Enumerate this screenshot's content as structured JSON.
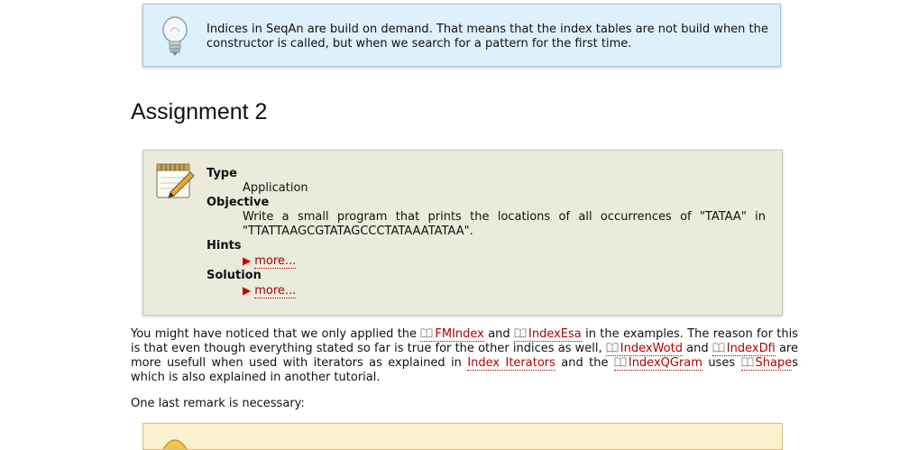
{
  "tip": {
    "text": "Indices in SeqAn are build on demand. That means that the index tables are not build when the constructor is called, but when we search for a pattern for the first time."
  },
  "assignment": {
    "title": "Assignment 2",
    "type_label": "Type",
    "type_value": "Application",
    "objective_label": "Objective",
    "objective_value": "Write a small program that prints the locations of all occurrences of \"TATAA\" in \"TTATTAAGCGTATAGCCCTATAAATATAA\".",
    "hints_label": "Hints",
    "hints_more": "more...",
    "solution_label": "Solution",
    "solution_more": "more..."
  },
  "paragraph": {
    "t1": "You might have noticed that we only applied the ",
    "link_fmindex": "FMIndex",
    "t2": " and ",
    "link_indexesa": "IndexEsa",
    "t3": " in the examples. The reason for this is that even though everything stated so far is true for the other indices as well, ",
    "link_indexwotd": "IndexWotd",
    "t4": " and ",
    "link_indexdfi": "IndexDfi",
    "t5": " are more usefull when used with iterators as explained in ",
    "link_index_iterators": "Index Iterators",
    "t6": " and the ",
    "link_indexqgram": "IndexQGram",
    "t7": " uses ",
    "link_shape": "Shape",
    "t8": "s which is also explained in another tutorial."
  },
  "remark": {
    "text": "One last remark is necessary:"
  }
}
